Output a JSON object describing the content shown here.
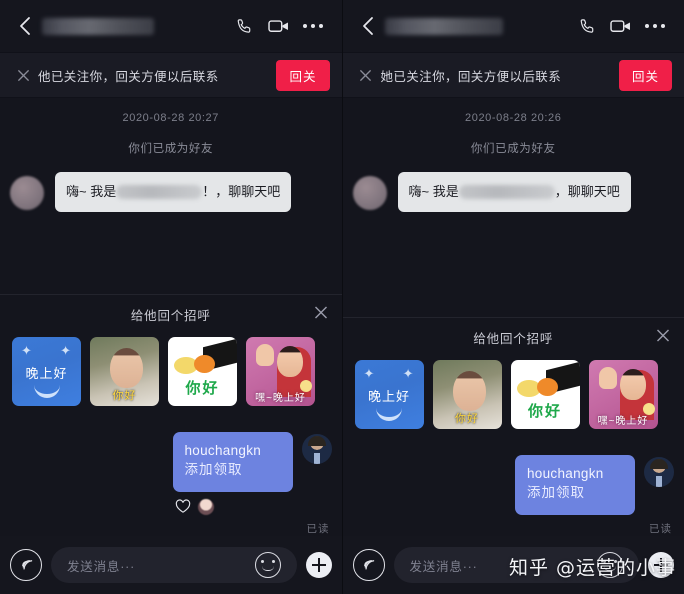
{
  "colors": {
    "background": "#14151d",
    "header": "#15161e",
    "banner": "#1a1b24",
    "accent_red": "#f01f48",
    "bubble_in": "#e4e6e8",
    "bubble_out": "#6d83e0",
    "input_bar": "#22232d"
  },
  "panels": [
    {
      "id": "left",
      "header": {
        "back_icon": "chevron-left-icon",
        "contact_name": "",
        "name_redacted": true,
        "call_icon": "phone-icon",
        "video_icon": "video-camera-icon",
        "more_icon": "more-horizontal-icon"
      },
      "banner": {
        "close_icon": "close-icon",
        "text": "他已关注你，回关方便以后联系",
        "button_label": "回关"
      },
      "conversation": {
        "timestamp": "2020-08-28 20:27",
        "system_note": "你们已成为好友",
        "incoming": {
          "prefix": "嗨~ 我是",
          "suffix": "！，聊聊天吧",
          "redacted": true
        },
        "outgoing": {
          "line1": "houchangkn",
          "line2": "添加领取",
          "read_status": "已读",
          "has_reaction": true,
          "reaction_icon": "heart-outline-icon"
        }
      },
      "greeting": {
        "title": "给他回个招呼",
        "close_icon": "close-icon",
        "stickers": [
          {
            "name": "sticker-good-evening",
            "label": "晚上好",
            "style": "st-night"
          },
          {
            "name": "sticker-girl-hello",
            "label": "你好",
            "style": "st-girl"
          },
          {
            "name": "sticker-paw-hello",
            "label": "你好",
            "style": "st-paw"
          },
          {
            "name": "sticker-waving-girl",
            "label": "嘿~晚上好",
            "style": "st-wave"
          }
        ]
      },
      "composer": {
        "voice_icon": "voice-wave-icon",
        "placeholder": "发送消息···",
        "emoji_icon": "smiley-icon",
        "plus_icon": "plus-icon"
      }
    },
    {
      "id": "right",
      "header": {
        "back_icon": "chevron-left-icon",
        "contact_name": "",
        "name_redacted": true,
        "call_icon": "phone-icon",
        "video_icon": "video-camera-icon",
        "more_icon": "more-horizontal-icon"
      },
      "banner": {
        "close_icon": "close-icon",
        "text": "她已关注你，回关方便以后联系",
        "button_label": "回关"
      },
      "conversation": {
        "timestamp": "2020-08-28 20:26",
        "system_note": "你们已成为好友",
        "incoming": {
          "prefix": "嗨~ 我是",
          "suffix": "，聊聊天吧",
          "redacted": true
        },
        "outgoing": {
          "line1": "houchangkn",
          "line2": "添加领取",
          "read_status": "已读",
          "has_reaction": false,
          "reaction_icon": ""
        }
      },
      "greeting": {
        "title": "给他回个招呼",
        "close_icon": "close-icon",
        "stickers": [
          {
            "name": "sticker-good-evening",
            "label": "晚上好",
            "style": "st-night"
          },
          {
            "name": "sticker-girl-hello",
            "label": "你好",
            "style": "st-girl"
          },
          {
            "name": "sticker-paw-hello",
            "label": "你好",
            "style": "st-paw"
          },
          {
            "name": "sticker-waving-girl",
            "label": "嘿~晚上好",
            "style": "st-wave"
          }
        ]
      },
      "composer": {
        "voice_icon": "voice-wave-icon",
        "placeholder": "发送消息···",
        "emoji_icon": "smiley-icon",
        "plus_icon": "plus-icon"
      }
    }
  ],
  "watermark": "知乎 @运营的小事"
}
